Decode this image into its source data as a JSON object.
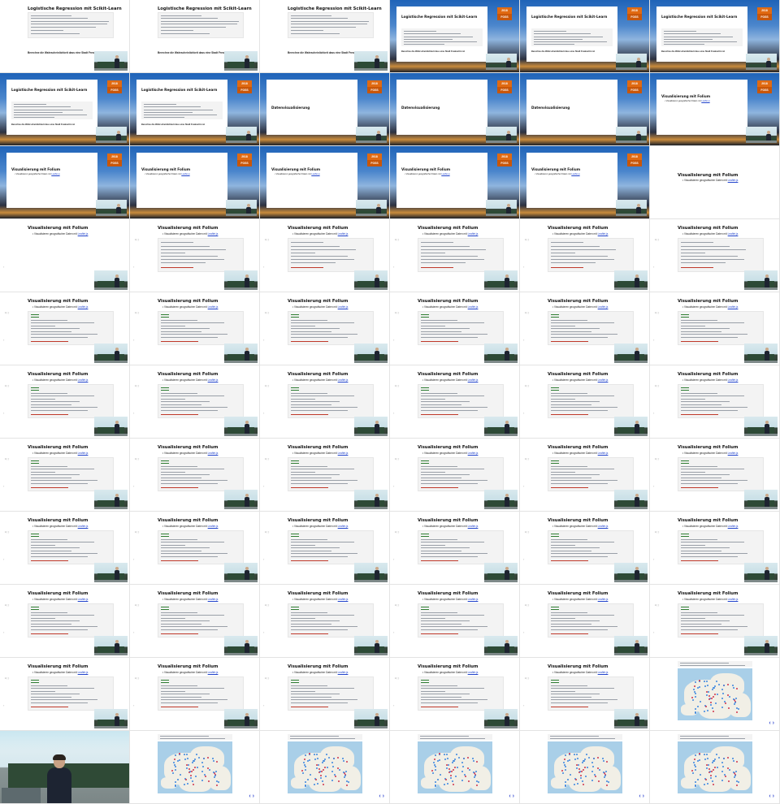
{
  "grid": {
    "columns": 6,
    "rows": 11
  },
  "text": {
    "logreg_title": "Logistische Regression mit Scikit-Learn",
    "logreg_note": "Berechne die Wahrscheinlichkeit dass eine Stadt Freakoritm ist",
    "datenvis_title": "Datenvisualisierung",
    "folium_title": "Visualisierung mit Folium",
    "folium_bullet_prefix": "Visualisieren geografischer Daten mit ",
    "folium_bullet_link": "Leaflet.js",
    "logo_top": "2018",
    "logo_bottom": "FOSS"
  },
  "tiles": [
    {
      "type": "logreg_plain"
    },
    {
      "type": "logreg_plain"
    },
    {
      "type": "logreg_plain_b"
    },
    {
      "type": "conf_logreg"
    },
    {
      "type": "conf_logreg"
    },
    {
      "type": "conf_logreg"
    },
    {
      "type": "conf_logreg"
    },
    {
      "type": "conf_logreg"
    },
    {
      "type": "conf_title"
    },
    {
      "type": "conf_title"
    },
    {
      "type": "conf_title"
    },
    {
      "type": "conf_folium_title"
    },
    {
      "type": "conf_folium"
    },
    {
      "type": "conf_folium"
    },
    {
      "type": "conf_folium"
    },
    {
      "type": "conf_folium"
    },
    {
      "type": "conf_folium"
    },
    {
      "type": "folium_intro"
    },
    {
      "type": "folium_empty"
    },
    {
      "type": "folium_code1"
    },
    {
      "type": "folium_code1"
    },
    {
      "type": "folium_code1"
    },
    {
      "type": "folium_code1"
    },
    {
      "type": "folium_code1"
    },
    {
      "type": "folium_code2"
    },
    {
      "type": "folium_code2"
    },
    {
      "type": "folium_code2"
    },
    {
      "type": "folium_code2"
    },
    {
      "type": "folium_code2"
    },
    {
      "type": "folium_code2"
    },
    {
      "type": "folium_code2"
    },
    {
      "type": "folium_code2"
    },
    {
      "type": "folium_code2"
    },
    {
      "type": "folium_code2"
    },
    {
      "type": "folium_code2"
    },
    {
      "type": "folium_code2"
    },
    {
      "type": "folium_code2"
    },
    {
      "type": "folium_code2"
    },
    {
      "type": "folium_code2"
    },
    {
      "type": "folium_code2"
    },
    {
      "type": "folium_code2"
    },
    {
      "type": "folium_code2"
    },
    {
      "type": "folium_code2"
    },
    {
      "type": "folium_code2"
    },
    {
      "type": "folium_code2"
    },
    {
      "type": "folium_code2"
    },
    {
      "type": "folium_code2"
    },
    {
      "type": "folium_code2"
    },
    {
      "type": "folium_code2"
    },
    {
      "type": "folium_code2"
    },
    {
      "type": "folium_code2"
    },
    {
      "type": "folium_code2"
    },
    {
      "type": "folium_code2"
    },
    {
      "type": "folium_code2"
    },
    {
      "type": "folium_code2"
    },
    {
      "type": "folium_code2"
    },
    {
      "type": "folium_code2"
    },
    {
      "type": "folium_code2"
    },
    {
      "type": "folium_code2"
    },
    {
      "type": "map"
    },
    {
      "type": "camera"
    },
    {
      "type": "map"
    },
    {
      "type": "map"
    },
    {
      "type": "map"
    },
    {
      "type": "map"
    },
    {
      "type": "map"
    }
  ],
  "colors": {
    "accent_link": "#2244cc",
    "logo_orange": "#e06a12",
    "nav_arrow": "#3a4fd0"
  },
  "icons": {
    "nav_next": "chevron-right-icon",
    "nav_prev": "chevron-left-icon"
  }
}
